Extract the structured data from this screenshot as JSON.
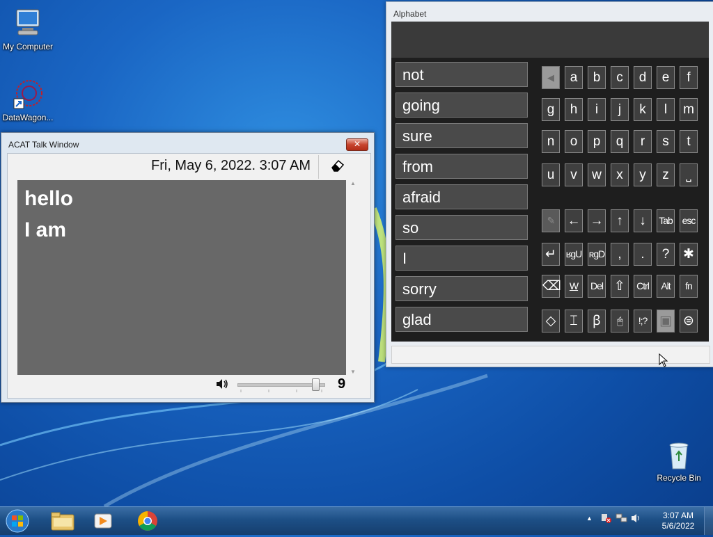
{
  "desktop": {
    "icons": [
      {
        "label": "My Computer"
      },
      {
        "label": "DataWagon..."
      },
      {
        "label": "Recycle Bin"
      }
    ]
  },
  "talk_window": {
    "title": "ACAT Talk Window",
    "close_glyph": "✕",
    "datetime": "Fri, May 6, 2022. 3:07 AM",
    "lines": [
      "hello",
      "I am"
    ],
    "volume_value": "9",
    "volume_level": 0.9
  },
  "alphabet_window": {
    "title": "Alphabet",
    "words": [
      "not",
      "going",
      "sure",
      "from",
      "afraid",
      "so",
      "I",
      "sorry",
      "glad"
    ],
    "letter_rows": [
      [
        "◀",
        "a",
        "b",
        "c",
        "d",
        "e",
        "f"
      ],
      [
        "g",
        "h",
        "i",
        "j",
        "k",
        "l",
        "m"
      ],
      [
        "n",
        "o",
        "p",
        "q",
        "r",
        "s",
        "t"
      ],
      [
        "u",
        "v",
        "w",
        "x",
        "y",
        "z",
        "⎵"
      ]
    ],
    "function_rows": [
      [
        "✎",
        "←",
        "→",
        "↑",
        "↓",
        "Tab",
        "esc"
      ],
      [
        "↵",
        "ʁgU",
        "ʀgD",
        ",",
        ".",
        "?",
        "✱"
      ],
      [
        "⌫",
        "W",
        "Del",
        "⇧",
        "Ctrl",
        "Alt",
        "fn"
      ],
      [
        "◇",
        "⌶",
        "ꞵ",
        "🖱",
        "!;?",
        "▣",
        "⊜"
      ]
    ]
  },
  "taskbar": {
    "time": "3:07 AM",
    "date": "5/6/2022",
    "tray_expand": "▲"
  },
  "colors": {
    "talk_text_bg": "#686868",
    "key_bg": "#3f3f3f",
    "taskbar": "#1d4f86"
  }
}
